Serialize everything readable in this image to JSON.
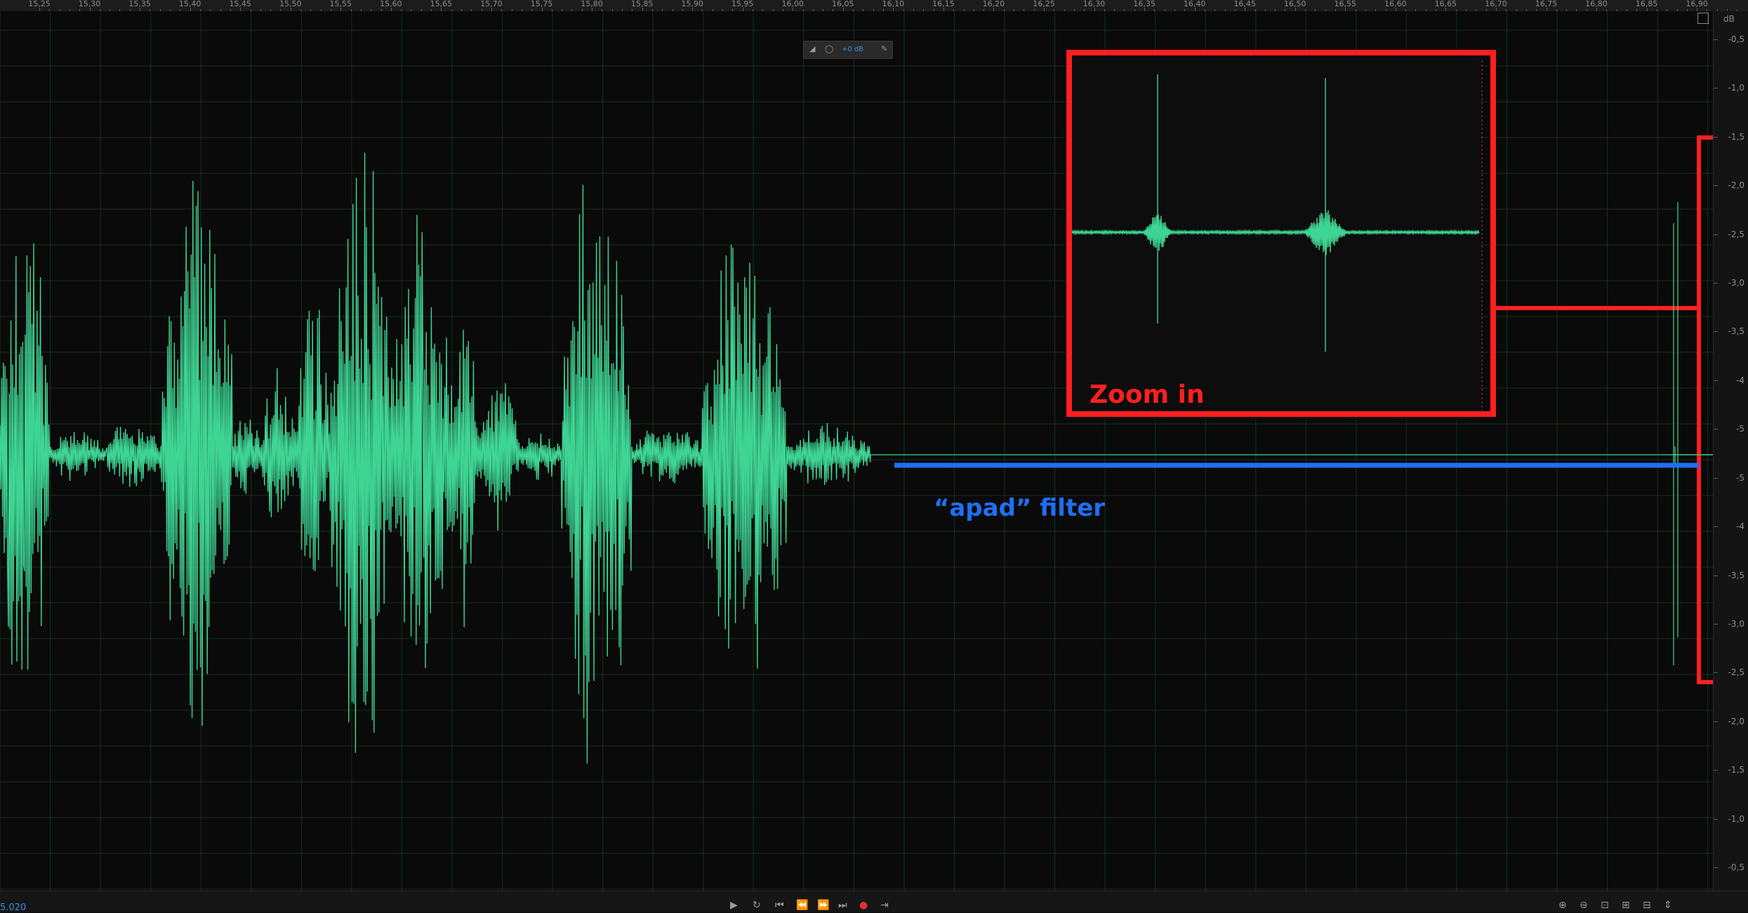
{
  "ruler": {
    "ticks": [
      "15,25",
      "15,30",
      "15,35",
      "15,40",
      "15,45",
      "15,50",
      "15,55",
      "15,60",
      "15,65",
      "15,70",
      "15,75",
      "15,80",
      "15,85",
      "15,90",
      "15,95",
      "16,00",
      "16,05",
      "16,10",
      "16,15",
      "16,20",
      "16,25",
      "16,30",
      "16,35",
      "16,40",
      "16,45",
      "16,50",
      "16,55",
      "16,60",
      "16,65",
      "16,70",
      "16,75",
      "16,80",
      "16,85",
      "16,90"
    ]
  },
  "scale": {
    "unit": "dB",
    "labels": [
      "-0,5",
      "-1,0",
      "-1,5",
      "-2,0",
      "-2,5",
      "-3,0",
      "-3,5",
      "-4",
      "-5",
      "-5",
      "-4",
      "-3,5",
      "-3,0",
      "-2,5",
      "-2,0",
      "-1,5",
      "-1,0",
      "-0,5"
    ]
  },
  "hud": {
    "gain": "+0 dB"
  },
  "annotations": {
    "zoom_label": "Zoom in",
    "apad_label": "“apad” filter"
  },
  "bottom": {
    "time": "5.020"
  },
  "colors": {
    "waveform": "#3ed494",
    "annotation_red": "#ff1f1f",
    "annotation_blue": "#1e6ff5",
    "grid": "#1f3a22"
  }
}
